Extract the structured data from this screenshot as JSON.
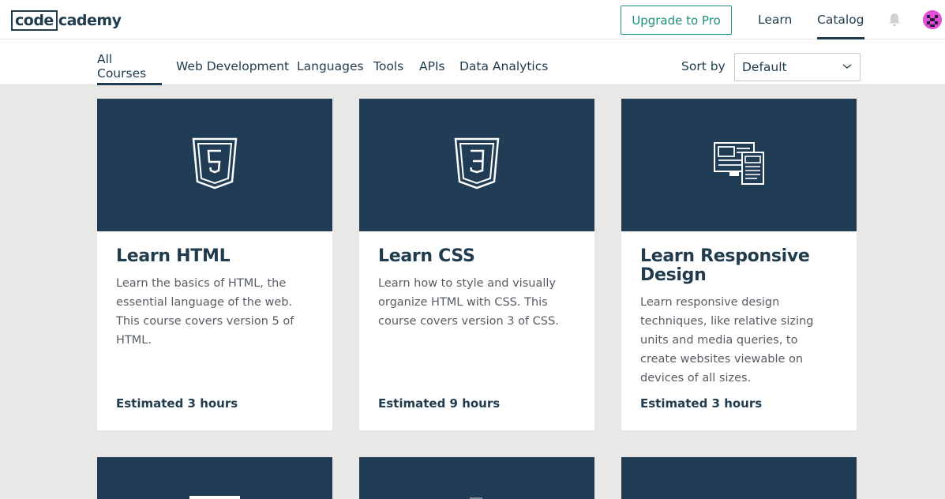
{
  "brand": {
    "logo_boxed": "code",
    "logo_rest": "cademy"
  },
  "topnav": {
    "upgrade": "Upgrade to Pro",
    "learn": "Learn",
    "catalog": "Catalog"
  },
  "tabs": [
    "All Courses",
    "Web Development",
    "Languages",
    "Tools",
    "APIs",
    "Data Analytics"
  ],
  "sort": {
    "label": "Sort by",
    "value": "Default"
  },
  "courses": [
    {
      "title": "Learn HTML",
      "description": "Learn the basics of HTML, the essential language of the web. This course covers version 5 of HTML.",
      "estimate": "Estimated 3 hours",
      "icon": "html5-icon"
    },
    {
      "title": "Learn CSS",
      "description": "Learn how to style and visually organize HTML with CSS. This course covers version 3 of CSS.",
      "estimate": "Estimated 9 hours",
      "icon": "css3-icon"
    },
    {
      "title": "Learn Responsive Design",
      "description": "Learn responsive design techniques, like relative sizing units and media queries, to create websites viewable on devices of all sizes.",
      "estimate": "Estimated 3 hours",
      "icon": "responsive-devices-icon"
    }
  ],
  "colors": {
    "hero": "#213d55",
    "accent": "#1f8f7e",
    "text": "#1f3b4d"
  }
}
